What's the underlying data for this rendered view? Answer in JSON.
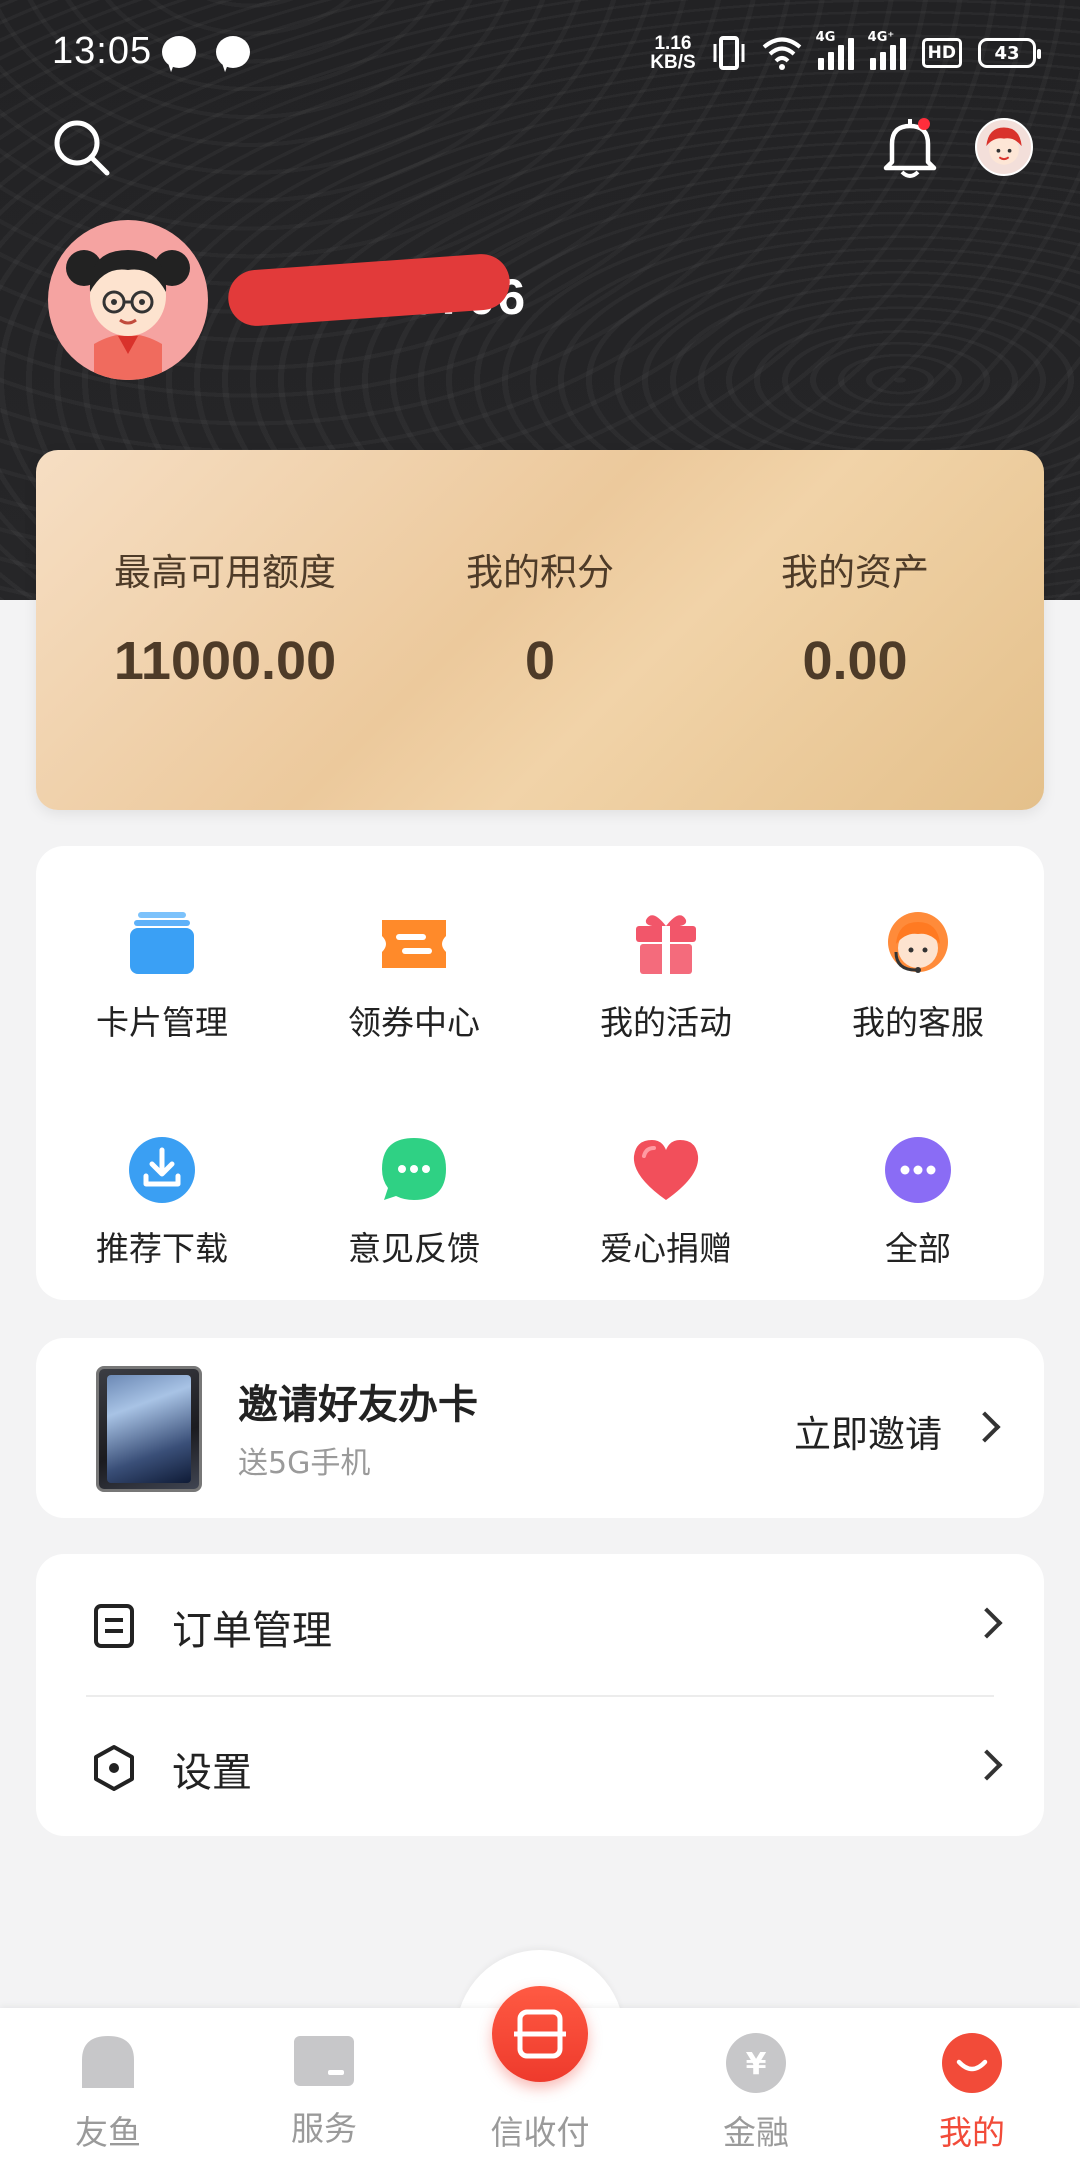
{
  "status_bar": {
    "time": "13:05",
    "speed_top": "1.16",
    "speed_unit": "KB/S",
    "network_1": "4G",
    "network_2": "4G⁺",
    "hd": "HD",
    "battery": "43"
  },
  "profile": {
    "phone_visible_suffix": "8706"
  },
  "stats": [
    {
      "label": "最高可用额度",
      "value": "11000.00"
    },
    {
      "label": "我的积分",
      "value": "0"
    },
    {
      "label": "我的资产",
      "value": "0.00"
    }
  ],
  "grid": [
    {
      "label": "卡片管理",
      "icon": "card-management-icon",
      "color": "#3aa0f5"
    },
    {
      "label": "领券中心",
      "icon": "coupon-icon",
      "color": "#ff8a2a"
    },
    {
      "label": "我的活动",
      "icon": "gift-icon",
      "color": "#f2566a"
    },
    {
      "label": "我的客服",
      "icon": "customer-service-icon",
      "color": "#ff8b3a"
    },
    {
      "label": "推荐下载",
      "icon": "download-icon",
      "color": "#3a9ff3"
    },
    {
      "label": "意见反馈",
      "icon": "feedback-icon",
      "color": "#2fd184"
    },
    {
      "label": "爱心捐赠",
      "icon": "heart-icon",
      "color": "#f24f5b"
    },
    {
      "label": "全部",
      "icon": "more-icon",
      "color": "#8a6cf5"
    }
  ],
  "invite": {
    "title": "邀请好友办卡",
    "subtitle": "送5G手机",
    "action": "立即邀请"
  },
  "menu": [
    {
      "label": "订单管理",
      "icon": "order-icon"
    },
    {
      "label": "设置",
      "icon": "settings-icon"
    }
  ],
  "tabs": [
    {
      "label": "友鱼",
      "icon": "home-icon",
      "active": false
    },
    {
      "label": "服务",
      "icon": "service-icon",
      "active": false
    },
    {
      "label": "信收付",
      "icon": "scan-pay-icon",
      "active": false
    },
    {
      "label": "金融",
      "icon": "yen-icon",
      "active": false
    },
    {
      "label": "我的",
      "icon": "profile-icon",
      "active": true
    }
  ],
  "colors": {
    "accent": "#f24b39",
    "header_bg": "#242426",
    "card_gold": "#ecc99c"
  }
}
